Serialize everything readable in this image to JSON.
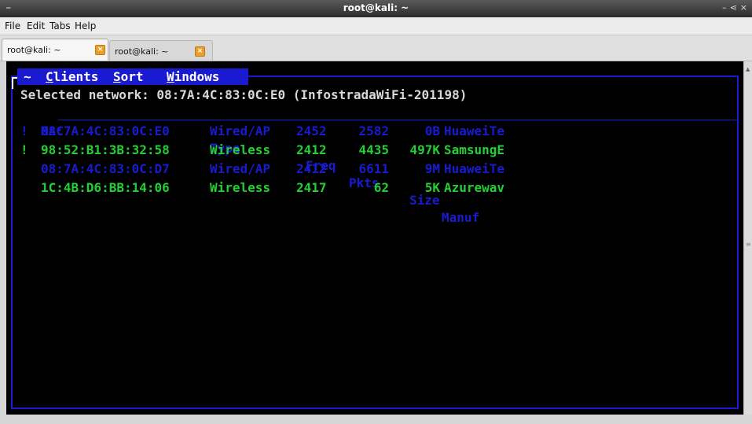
{
  "window": {
    "title": "root@kali: ~"
  },
  "menubar": {
    "file": "File",
    "edit": "Edit",
    "tabs": "Tabs",
    "help": "Help"
  },
  "tabs": [
    {
      "label": "root@kali: ~",
      "active": true
    },
    {
      "label": "root@kali: ~",
      "active": false
    }
  ],
  "kismet": {
    "menu": {
      "tilde": "~",
      "clients": "Clients",
      "sort": "Sort",
      "windows": "Windows"
    },
    "selected_network": "Selected network: 08:7A:4C:83:0C:E0 (InfostradaWiFi-201198)",
    "columns": {
      "mac": "MAC",
      "type": "Type",
      "freq": "Freq",
      "pkts": "Pkts",
      "size": "Size",
      "manuf": "Manuf"
    },
    "rows": [
      {
        "flag": "!",
        "mac": "08:7A:4C:83:0C:E0",
        "type": "Wired/AP",
        "freq": "2452",
        "pkts": "2582",
        "size": "0B",
        "manuf": "HuaweiTe",
        "color": "#1a1ad0"
      },
      {
        "flag": "!",
        "mac": "98:52:B1:3B:32:58",
        "type": "Wireless",
        "freq": "2412",
        "pkts": "4435",
        "size": "497K",
        "manuf": "SamsungE",
        "color": "#22d033"
      },
      {
        "flag": "",
        "mac": "08:7A:4C:83:0C:D7",
        "type": "Wired/AP",
        "freq": "2412",
        "pkts": "6611",
        "size": "9M",
        "manuf": "HuaweiTe",
        "color": "#1a1ad0"
      },
      {
        "flag": "",
        "mac": "1C:4B:D6:BB:14:06",
        "type": "Wireless",
        "freq": "2417",
        "pkts": "62",
        "size": "5K",
        "manuf": "Azurewav",
        "color": "#22d033"
      }
    ]
  },
  "icons": {
    "app": "terminal-icon",
    "tab_close": "close-icon"
  }
}
